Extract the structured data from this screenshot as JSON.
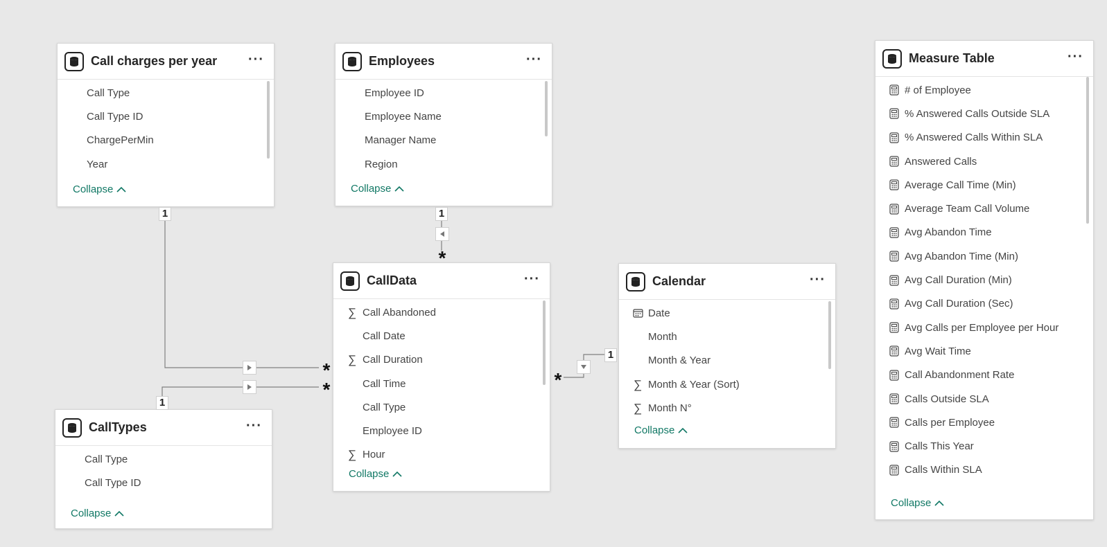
{
  "tables": {
    "call_charges": {
      "title": "Call charges per year",
      "fields": [
        {
          "label": "Call Type",
          "icon": "none"
        },
        {
          "label": "Call Type ID",
          "icon": "none"
        },
        {
          "label": "ChargePerMin",
          "icon": "none"
        },
        {
          "label": "Year",
          "icon": "none"
        }
      ],
      "collapse_label": "Collapse"
    },
    "employees": {
      "title": "Employees",
      "fields": [
        {
          "label": "Employee ID",
          "icon": "none"
        },
        {
          "label": "Employee Name",
          "icon": "none"
        },
        {
          "label": "Manager Name",
          "icon": "none"
        },
        {
          "label": "Region",
          "icon": "none"
        }
      ],
      "collapse_label": "Collapse"
    },
    "calldata": {
      "title": "CallData",
      "fields": [
        {
          "label": "Call Abandoned",
          "icon": "sigma"
        },
        {
          "label": "Call Date",
          "icon": "none"
        },
        {
          "label": "Call Duration",
          "icon": "sigma"
        },
        {
          "label": "Call Time",
          "icon": "none"
        },
        {
          "label": "Call Type",
          "icon": "none"
        },
        {
          "label": "Employee ID",
          "icon": "none"
        },
        {
          "label": "Hour",
          "icon": "sigma"
        }
      ],
      "collapse_label": "Collapse"
    },
    "calendar": {
      "title": "Calendar",
      "fields": [
        {
          "label": "Date",
          "icon": "calendar"
        },
        {
          "label": "Month",
          "icon": "none"
        },
        {
          "label": "Month & Year",
          "icon": "none"
        },
        {
          "label": "Month & Year (Sort)",
          "icon": "sigma"
        },
        {
          "label": "Month N°",
          "icon": "sigma"
        }
      ],
      "collapse_label": "Collapse"
    },
    "calltypes": {
      "title": "CallTypes",
      "fields": [
        {
          "label": "Call Type",
          "icon": "none"
        },
        {
          "label": "Call Type ID",
          "icon": "none"
        }
      ],
      "collapse_label": "Collapse"
    },
    "measure_table": {
      "title": "Measure Table",
      "fields": [
        {
          "label": "# of Employee",
          "icon": "calculator"
        },
        {
          "label": "% Answered Calls Outside SLA",
          "icon": "calculator"
        },
        {
          "label": "% Answered Calls Within SLA",
          "icon": "calculator"
        },
        {
          "label": "Answered Calls",
          "icon": "calculator"
        },
        {
          "label": "Average Call Time (Min)",
          "icon": "calculator"
        },
        {
          "label": "Average Team Call Volume",
          "icon": "calculator"
        },
        {
          "label": "Avg Abandon Time",
          "icon": "calculator"
        },
        {
          "label": "Avg Abandon Time (Min)",
          "icon": "calculator"
        },
        {
          "label": "Avg Call Duration (Min)",
          "icon": "calculator"
        },
        {
          "label": "Avg Call Duration (Sec)",
          "icon": "calculator"
        },
        {
          "label": "Avg Calls per Employee per Hour",
          "icon": "calculator"
        },
        {
          "label": "Avg Wait Time",
          "icon": "calculator"
        },
        {
          "label": "Call Abandonment Rate",
          "icon": "calculator"
        },
        {
          "label": "Calls Outside SLA",
          "icon": "calculator"
        },
        {
          "label": "Calls per Employee",
          "icon": "calculator"
        },
        {
          "label": "Calls This Year",
          "icon": "calculator"
        },
        {
          "label": "Calls Within SLA",
          "icon": "calculator"
        }
      ],
      "collapse_label": "Collapse"
    }
  },
  "more_label": "···",
  "relationships": {
    "one_label": "1",
    "many_label": "*"
  },
  "colors": {
    "canvas": "#e8e8e8",
    "collapse_link": "#117865",
    "line": "#808080"
  }
}
